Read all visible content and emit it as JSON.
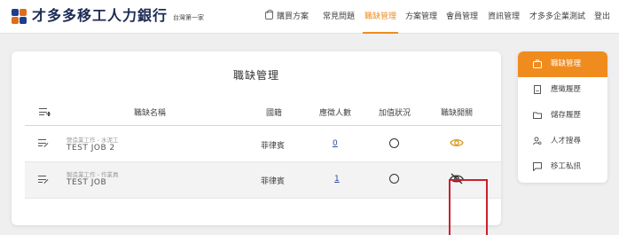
{
  "brand": {
    "name": "才多多移工人力銀行",
    "subtitle": "台灣第一家"
  },
  "nav": {
    "buy_plan": "購買方案",
    "faq": "常見問題",
    "job_manage": "職缺管理",
    "plan_manage": "方案管理",
    "member_manage": "會員管理",
    "info_manage": "資訊管理",
    "account": "才多多企業測試",
    "logout": "登出"
  },
  "main": {
    "title": "職缺管理",
    "columns": {
      "name": "職缺名稱",
      "nationality": "國籍",
      "applicants": "應徵人數",
      "boost": "加值狀況",
      "visibility": "職缺開關"
    },
    "rows": [
      {
        "category": "營造業工作 - 水泥工",
        "name": "TEST JOB 2",
        "nationality": "菲律賓",
        "applicants": "0",
        "boost": "off",
        "visibility": "shown"
      },
      {
        "category": "製造業工作 - 作業員",
        "name": "TEST JOB",
        "nationality": "菲律賓",
        "applicants": "1",
        "boost": "off",
        "visibility": "hidden"
      }
    ]
  },
  "sidebar": {
    "items": [
      {
        "label": "職缺管理",
        "icon": "briefcase-icon",
        "active": true
      },
      {
        "label": "應徵履歷",
        "icon": "document-icon",
        "active": false
      },
      {
        "label": "儲存履歷",
        "icon": "folder-icon",
        "active": false
      },
      {
        "label": "人才搜尋",
        "icon": "user-search-icon",
        "active": false
      },
      {
        "label": "移工私訊",
        "icon": "chat-icon",
        "active": false
      }
    ]
  },
  "colors": {
    "accent": "#f08c1e",
    "brand_blue": "#1c3f8c",
    "highlight_red": "#cc1f2d"
  }
}
